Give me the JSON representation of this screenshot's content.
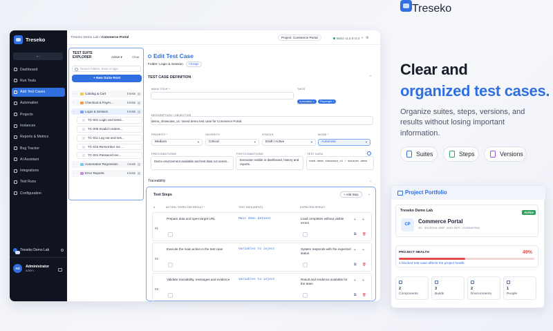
{
  "app": {
    "name": "Treseko",
    "collapse_icon": "arrow-left",
    "sidebar": [
      {
        "label": "Dashboard",
        "active": false
      },
      {
        "label": "Run Tests",
        "active": false
      },
      {
        "label": "Add Test Cases",
        "active": true
      },
      {
        "label": "Automation",
        "active": false
      },
      {
        "label": "Projects",
        "active": false
      },
      {
        "label": "Instances",
        "active": false
      },
      {
        "label": "Reports & Metrics",
        "active": false
      },
      {
        "label": "Bug Tracker",
        "active": false
      },
      {
        "label": "AI Assistant",
        "active": false
      },
      {
        "label": "Integrations",
        "active": false
      },
      {
        "label": "Test Runs",
        "active": false
      },
      {
        "label": "Configuration",
        "active": false
      }
    ],
    "workspace": "Treseko Demo Lab",
    "user": {
      "initials": "AD",
      "name": "Administrator",
      "role": "admin"
    },
    "topbar": {
      "crumb_org": "Treseko Demo Lab",
      "crumb_sep": "/",
      "crumb_project": "Commerce Portal",
      "project_select": "Project: Commerce Portal",
      "build": "Build: v1.6.0-r2.3"
    },
    "explorer": {
      "title": "TEST SUITE EXPLORER",
      "filter": "Active",
      "clear": "Clear",
      "search_placeholder": "Search folders, tests or tags",
      "new_suite": "+ New Suite Root",
      "nodes": [
        {
          "label": "Catalog & Cart",
          "count": "5 tests",
          "color": "#f2c94c",
          "child": false,
          "selected": false
        },
        {
          "label": "Checkout & Paym...",
          "count": "5 tests",
          "color": "#f2994a",
          "child": false,
          "selected": false
        },
        {
          "label": "Login & Session",
          "count": "5 tests",
          "color": "#7aa3ef",
          "child": false,
          "selected": true
        },
        {
          "label": "TC-001 Login and sessi...",
          "count": "",
          "color": "#dbe3ee",
          "child": true,
          "selected": false
        },
        {
          "label": "TC-005 Invalid credent...",
          "count": "",
          "color": "#dbe3ee",
          "child": true,
          "selected": false
        },
        {
          "label": "TC-011 Log out and ses...",
          "count": "",
          "color": "#dbe3ee",
          "child": true,
          "selected": false
        },
        {
          "label": "TC-016 Remember me ...",
          "count": "",
          "color": "#dbe3ee",
          "child": true,
          "selected": false
        },
        {
          "label": "TC-021 Password res...",
          "count": "",
          "color": "#dbe3ee",
          "child": true,
          "selected": false
        },
        {
          "label": "Automation Regression",
          "count": "4 tests",
          "color": "#7bc4e8",
          "child": false,
          "selected": false
        },
        {
          "label": "Error Reports",
          "count": "5 tests",
          "color": "#c98de0",
          "child": false,
          "selected": false
        }
      ]
    },
    "editor": {
      "title": "Edit Test Case",
      "folder_label": "Folder: Login & Session",
      "change": "Change",
      "section": "TEST CASE DEFINITION",
      "main_title_label": "MAIN TITLE *",
      "tc_id": "TC-021",
      "tc_title": "TC-021 - Login and session - demo scenario 21",
      "tags_label": "TAGS",
      "tags": [
        "Automated ×",
        "Playwright ×"
      ],
      "add_tag": "Add another...",
      "desc_label": "DESCRIPTION / OBJECTIVE",
      "description": "demo_showcase_v1: mixed demo test case for Commerce Portal.",
      "priority_label": "PRIORITY *",
      "priority": "Medium",
      "severity_label": "SEVERITY",
      "severity": "Critical",
      "status_label": "STATUS",
      "status": "Draft / Active",
      "mode_label": "MODE *",
      "mode": "Automatic",
      "pre_label": "PRECONDITIONS",
      "pre": "Demo environment available and test data not sensit...",
      "post_label": "POSTCONDITIONS",
      "post": "Execution visible in dashboard, history and reports.",
      "data_label": "TEST DATA",
      "data": "seed-demo_showcase_v1 / dataset-demo",
      "traceability": "Traceability",
      "steps_title": "Test Steps",
      "add_step": "+ Add Step",
      "cols": [
        "#",
        "ACTION / EXPECTED RESULT *",
        "TEST DATA (INPUT)",
        "EXPECTED RESULT"
      ],
      "steps": [
        {
          "n": "#1",
          "action": "Prepare data and open target URL",
          "data": "Main demo dataset",
          "expected": "Load completes without visible errors"
        },
        {
          "n": "#2",
          "action": "Execute the main action in the test case",
          "data": "Variables to inject",
          "expected": "System responds with the expected status"
        },
        {
          "n": "#3",
          "action": "Validate traceability, messages and evidence",
          "data": "Variables to inject",
          "expected": "Result and evidence available for the team"
        }
      ]
    }
  },
  "promo": {
    "brand": "Treseko",
    "headline_1": "Clear and",
    "headline_2": "organized test cases.",
    "description": "Organize suites, steps, versions, and results without losing important information.",
    "chips": [
      {
        "label": "Suites",
        "icon": "document-icon",
        "color": "#2f6fe0"
      },
      {
        "label": "Steps",
        "icon": "checklist-icon",
        "color": "#22a06b"
      },
      {
        "label": "Versions",
        "icon": "versions-icon",
        "color": "#9b51e0"
      }
    ]
  },
  "portfolio": {
    "title": "Project Portfolio",
    "org": "Treseko Demo Lab",
    "status": "Active",
    "initials": "CP",
    "project": "Commerce Portal",
    "id": "ID: 9614E21A-A59F-4491-B07C-C5259A6763A",
    "health_label": "PROJECT HEALTH",
    "health_value": "49%",
    "health_fraction": 0.49,
    "health_note": "1 blocked test case affects the project health.",
    "stats": [
      {
        "value": "2",
        "label": "Components"
      },
      {
        "value": "3",
        "label": "Builds"
      },
      {
        "value": "2",
        "label": "Environments"
      },
      {
        "value": "1",
        "label": "People"
      }
    ]
  }
}
